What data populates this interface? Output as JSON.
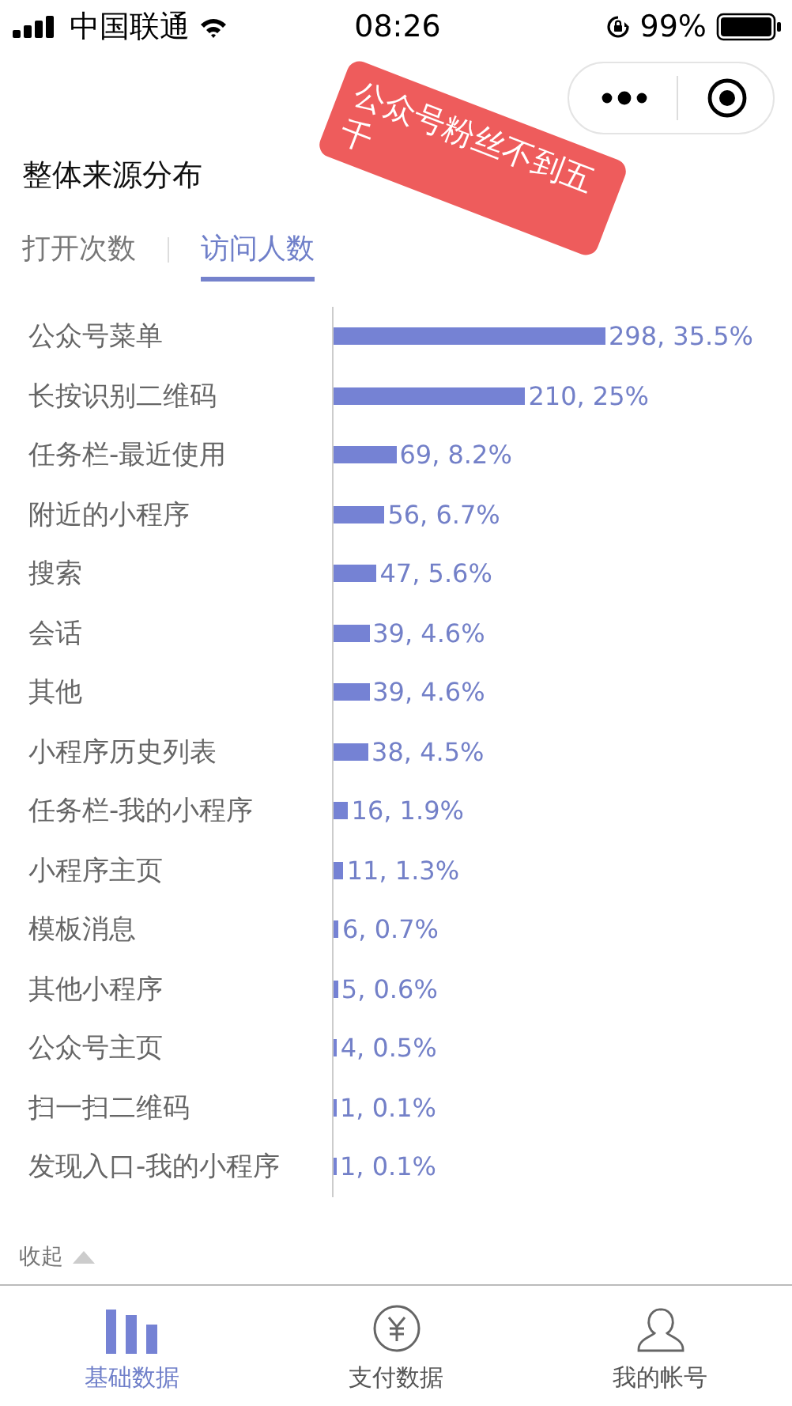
{
  "status_bar": {
    "carrier": "中国联通",
    "time": "08:26",
    "battery": "99%"
  },
  "sticker": {
    "text": "公众号粉丝不到五千"
  },
  "section_title": "整体来源分布",
  "tabs": [
    {
      "label": "打开次数",
      "selected": false
    },
    {
      "label": "访问人数",
      "selected": true
    }
  ],
  "rows": [
    {
      "label": "公众号菜单",
      "level": 0.593,
      "reading": "298, 35.5%"
    },
    {
      "label": "长按识别二维码",
      "level": 0.418,
      "reading": "210, 25%"
    },
    {
      "label": "任务栏-最近使用",
      "level": 0.137,
      "reading": "69, 8.2%"
    },
    {
      "label": "附近的小程序",
      "level": 0.111,
      "reading": "56, 6.7%"
    },
    {
      "label": "搜索",
      "level": 0.094,
      "reading": "47, 5.6%"
    },
    {
      "label": "会话",
      "level": 0.078,
      "reading": "39, 4.6%"
    },
    {
      "label": "其他",
      "level": 0.078,
      "reading": "39, 4.6%"
    },
    {
      "label": "小程序历史列表",
      "level": 0.076,
      "reading": "38, 4.5%"
    },
    {
      "label": "任务栏-我的小程序",
      "level": 0.032,
      "reading": "16, 1.9%"
    },
    {
      "label": "小程序主页",
      "level": 0.022,
      "reading": "11, 1.3%"
    },
    {
      "label": "模板消息",
      "level": 0.012,
      "reading": "6, 0.7%"
    },
    {
      "label": "其他小程序",
      "level": 0.01,
      "reading": "5, 0.6%"
    },
    {
      "label": "公众号主页",
      "level": 0.008,
      "reading": "4, 0.5%"
    },
    {
      "label": "扫一扫二维码",
      "level": 0.002,
      "reading": "1, 0.1%"
    },
    {
      "label": "发现入口-我的小程序",
      "level": 0.002,
      "reading": "1, 0.1%"
    }
  ],
  "collapse": "收起",
  "tab_bar": [
    {
      "kind": "chart",
      "label": "基础数据",
      "selected": true
    },
    {
      "kind": "pay",
      "label": "支付数据",
      "selected": false
    },
    {
      "kind": "user",
      "label": "我的帐号",
      "selected": false
    }
  ]
}
